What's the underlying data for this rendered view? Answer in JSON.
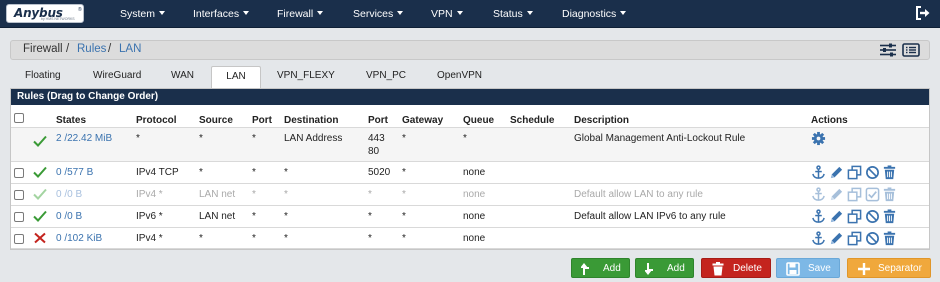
{
  "brand": {
    "name": "Anybus",
    "reg": "®",
    "tagline": "by HMS NETWORKS"
  },
  "nav": {
    "items": [
      "System",
      "Interfaces",
      "Firewall",
      "Services",
      "VPN",
      "Status",
      "Diagnostics"
    ]
  },
  "breadcrumb": [
    "Firewall",
    "/",
    "Rules",
    "/",
    "LAN"
  ],
  "tabs": [
    "Floating",
    "WireGuard",
    "WAN",
    "LAN",
    "VPN_FLEXY",
    "VPN_PC",
    "OpenVPN"
  ],
  "active_tab": "LAN",
  "panel": {
    "title": "Rules (Drag to Change Order)"
  },
  "columns": [
    "States",
    "Protocol",
    "Source",
    "Port",
    "Destination",
    "Port",
    "Gateway",
    "Queue",
    "Schedule",
    "Description",
    "Actions"
  ],
  "rows": [
    {
      "states": "2 /22.42 MiB",
      "protocol": "*",
      "source": "*",
      "sport": "*",
      "destination": "LAN Address",
      "dport": "443",
      "dport2": "80",
      "gateway": "*",
      "queue": "*",
      "schedule": "",
      "description": "Global Management Anti-Lockout Rule",
      "status": "pass",
      "enabled": true
    },
    {
      "states": "0 /577 B",
      "protocol": "IPv4 TCP",
      "source": "*",
      "sport": "*",
      "destination": "*",
      "dport": "5020",
      "gateway": "*",
      "queue": "none",
      "schedule": "",
      "description": "",
      "status": "pass",
      "enabled": true
    },
    {
      "states": "0 /0 B",
      "protocol": "IPv4 *",
      "source": "LAN net",
      "sport": "*",
      "destination": "*",
      "dport": "*",
      "gateway": "*",
      "queue": "none",
      "schedule": "",
      "description": "Default allow LAN to any rule",
      "status": "pass",
      "enabled": false
    },
    {
      "states": "0 /0 B",
      "protocol": "IPv6 *",
      "source": "LAN net",
      "sport": "*",
      "destination": "*",
      "dport": "*",
      "gateway": "*",
      "queue": "none",
      "schedule": "",
      "description": "Default allow LAN IPv6 to any rule",
      "status": "pass",
      "enabled": true
    },
    {
      "states": "0 /102 KiB",
      "protocol": "IPv4 *",
      "source": "*",
      "sport": "*",
      "destination": "*",
      "dport": "*",
      "gateway": "*",
      "queue": "none",
      "schedule": "",
      "description": "",
      "status": "block",
      "enabled": true
    }
  ],
  "buttons": {
    "add_top": "Add",
    "add_bottom": "Add",
    "delete": "Delete",
    "save": "Save",
    "separator": "Separator"
  },
  "colors": {
    "navbar": "#1a2f4b",
    "link": "#3b73af",
    "pass": "#3a9a36",
    "block": "#c4241e",
    "add": "#3a9a36",
    "delete": "#c4241e",
    "save": "#7db8e6",
    "separator": "#f0a83c"
  }
}
